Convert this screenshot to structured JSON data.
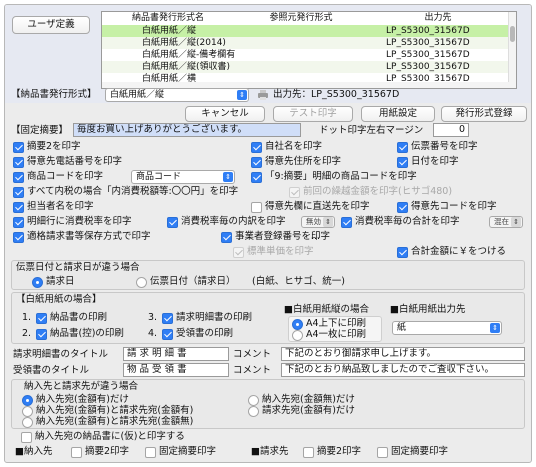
{
  "header": {
    "user_def_button": "ユーザ定義",
    "table": {
      "columns": [
        "納品書発行形式名",
        "参照元発行形式",
        "出力先"
      ],
      "rows": [
        {
          "name": "白紙用紙／縦",
          "ref": "",
          "out": "LP_S5300_31567D",
          "selected": true
        },
        {
          "name": "白紙用紙／縦(2014)",
          "ref": "",
          "out": "LP_S5300_31567D",
          "selected": false
        },
        {
          "name": "白紙用紙／縦-備考欄有",
          "ref": "",
          "out": "LP_S5300_31567D",
          "selected": false
        },
        {
          "name": "白紙用紙／縦(領収書)",
          "ref": "",
          "out": "LP_S5300_31567D",
          "selected": false
        },
        {
          "name": "白紙用紙／横",
          "ref": "",
          "out": "LP_S5300_31567D",
          "selected": false
        }
      ]
    },
    "format_label": "【納品書発行形式】",
    "format_value": "白紙用紙／縦",
    "output_label": "出力先：LP_S5300_31567D"
  },
  "buttons": {
    "cancel": "キャンセル",
    "test_print": "テスト印字",
    "paper_setting": "用紙設定",
    "register": "発行形式登録"
  },
  "fixed": {
    "label": "【固定摘要】",
    "value": "毎度お買い上げありがとうございます。",
    "margin_label": "ドット印字左右マージン",
    "margin_value": "0"
  },
  "options": {
    "teki2": "摘要2を印字",
    "company_name": "自社名を印字",
    "slip_no": "伝票番号を印字",
    "cust_phone": "得意先電話番号を印字",
    "cust_address": "得意先住所を印字",
    "date": "日付を印字",
    "product_code": "商品コードを印字",
    "product_code_select": "商品コード",
    "teki9": "「9:摘要」明細の商品コードを印字",
    "tax_in": "すべて内税の場合「内消費税額等:〇〇円」を印字",
    "prev_balance": "前回の繰越金額を印字(ヒサゴ480)",
    "person": "担当者名を印字",
    "direct_send": "得意先欄に直送先を印字",
    "cust_code": "得意先コードを印字",
    "line_tax": "明細行に消費税率を印字",
    "tax_breakdown": "消費税率毎の内訳を印字",
    "tax_breakdown_select": "無効",
    "tax_total": "消費税率毎の合計を印字",
    "tax_total_select": "混在",
    "invoice_keep": "適格請求書等保存方式で印字",
    "reg_no": "事業者登録番号を印字",
    "reg_no_more": "...",
    "unit_price": "標準単価を印字",
    "yen_mark": "合計金額に￥をつける"
  },
  "slip_date": {
    "title": "伝票日付と請求日が違う場合",
    "opt1": "請求日",
    "opt2": "伝票日付（請求日）",
    "note": "(白紙、ヒサゴ、統一)"
  },
  "blank": {
    "title": "【白紙用紙の場合】",
    "o1": "1.",
    "o1_label": "納品書の印刷",
    "o2": "2.",
    "o2_label": "納品書(控)の印刷",
    "o3": "3.",
    "o3_label": "請求明細書の印刷",
    "o4": "4.",
    "o4_label": "受領書の印刷",
    "size_title": "■白紙用紙縦の場合",
    "size_opt1": "A4上下に印刷",
    "size_opt2": "A4一枚に印刷",
    "dest_title": "■白紙用紙出力先",
    "dest_select": "紙"
  },
  "titles": {
    "invoice_label": "請求明細書のタイトル",
    "invoice_value": "請 求 明 細 書",
    "receipt_label": "受領書のタイトル",
    "receipt_value": "物 品 受 領 書",
    "comment_label": "コメント",
    "comment1": "下記のとおり御請求申し上げます。",
    "comment2": "下記のとおり納品致しましたのでご査収下さい。"
  },
  "dest": {
    "title": "納入先と請求先が違う場合",
    "l1": "納入先宛(金額有)だけ",
    "l2": "納入先宛(金額有)と請求先宛(金額有)",
    "l3": "納入先宛(金額有)と請求先宛(金額無)",
    "r1": "納入先宛(金額無)だけ",
    "r2": "請求先宛(金額有)だけ"
  },
  "bottom": {
    "note": "納入先宛の納品書に(仮)と印字する",
    "g1": "■納入先",
    "g1_a": "摘要2印字",
    "g1_b": "固定摘要印字",
    "g2": "■請求先",
    "g2_a": "摘要2印字",
    "g2_b": "固定摘要印字"
  },
  "colors": {
    "accent": "#2f7ef5",
    "selected_row": "#c6f0a6",
    "fixed_highlight": "#d0def8"
  }
}
